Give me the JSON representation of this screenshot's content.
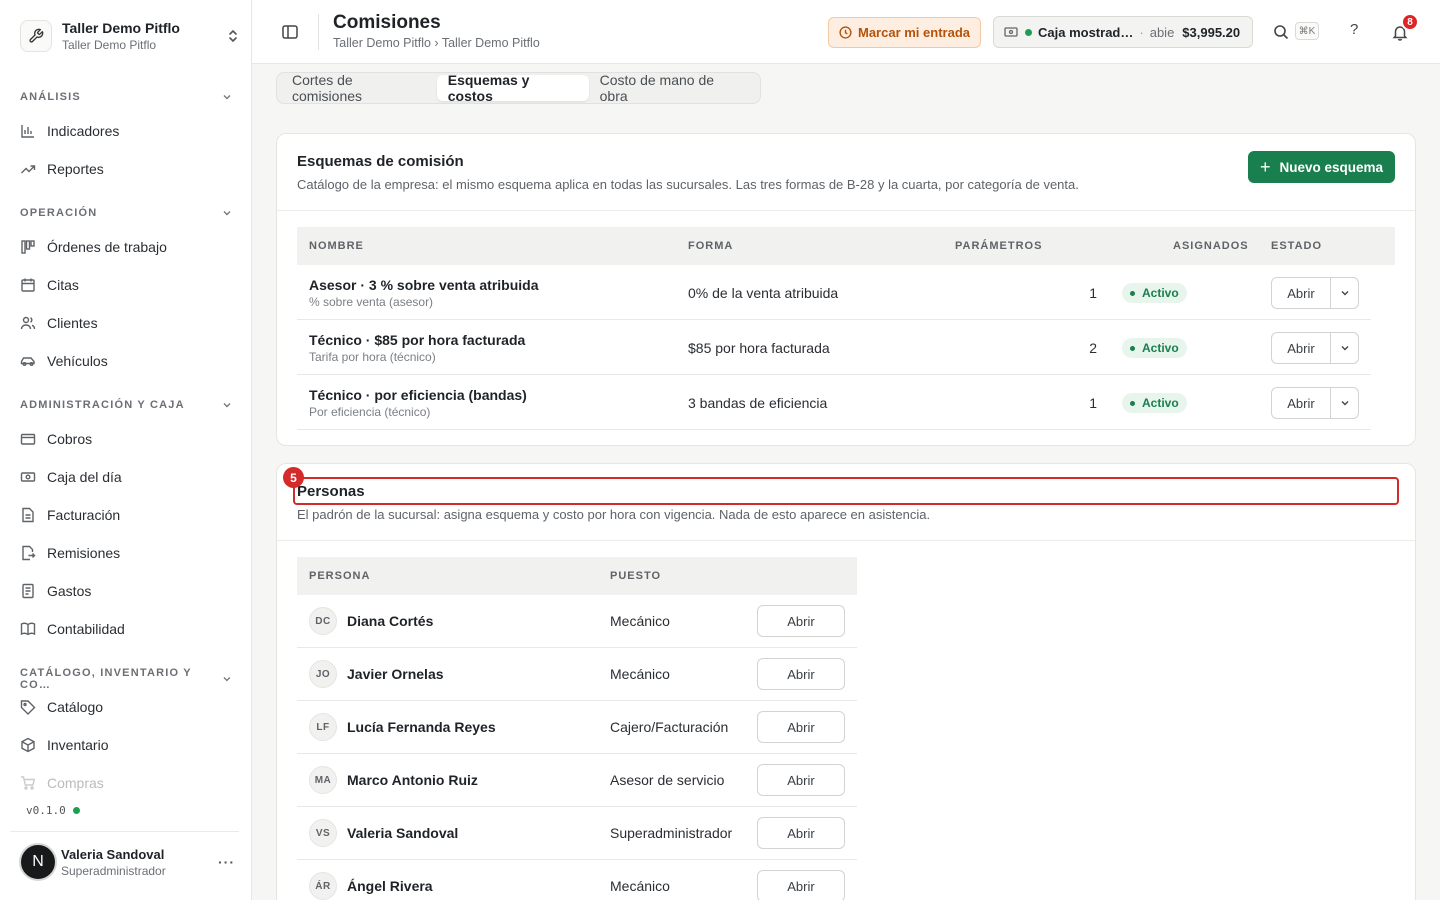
{
  "org": {
    "name": "Taller Demo Pitflo",
    "subtitle": "Taller Demo Pitflo"
  },
  "sidebar": {
    "sections": [
      {
        "label": "ANÁLISIS"
      },
      {
        "label": "OPERACIÓN"
      },
      {
        "label": "ADMINISTRACIÓN Y CAJA"
      },
      {
        "label": "CATÁLOGO, INVENTARIO Y CO…"
      }
    ],
    "items": [
      {
        "label": "Indicadores",
        "icon": "bar-chart-icon"
      },
      {
        "label": "Reportes",
        "icon": "trend-icon"
      },
      {
        "label": "Órdenes de trabajo",
        "icon": "kanban-icon"
      },
      {
        "label": "Citas",
        "icon": "calendar-icon"
      },
      {
        "label": "Clientes",
        "icon": "users-icon"
      },
      {
        "label": "Vehículos",
        "icon": "car-icon"
      },
      {
        "label": "Cobros",
        "icon": "wallet-icon"
      },
      {
        "label": "Caja del día",
        "icon": "cash-icon"
      },
      {
        "label": "Facturación",
        "icon": "file-icon"
      },
      {
        "label": "Remisiones",
        "icon": "file-export-icon"
      },
      {
        "label": "Gastos",
        "icon": "receipt-icon"
      },
      {
        "label": "Contabilidad",
        "icon": "book-icon"
      },
      {
        "label": "Catálogo",
        "icon": "tag-icon"
      },
      {
        "label": "Inventario",
        "icon": "box-icon"
      },
      {
        "label": "Compras",
        "icon": "cart-icon"
      }
    ],
    "version": "v0.1.0",
    "user": {
      "initial": "N",
      "name": "Valeria Sandoval",
      "role": "Superadministrador",
      "more": "···"
    }
  },
  "header": {
    "title": "Comisiones",
    "breadcrumb": "Taller Demo Pitflo › Taller Demo Pitflo",
    "clock_in": "Marcar mi entrada",
    "register": {
      "name": "Caja mostrad…",
      "separator": "·",
      "state": "abie",
      "amount": "$3,995.20"
    },
    "shortcut": "⌘K",
    "help": "?",
    "notifications": "8"
  },
  "tabs": [
    {
      "label": "Cortes de comisiones"
    },
    {
      "label": "Esquemas y costos"
    },
    {
      "label": "Costo de mano de obra"
    }
  ],
  "schemes": {
    "title": "Esquemas de comisión",
    "description": "Catálogo de la empresa: el mismo esquema aplica en todas las sucursales. Las tres formas de B-28 y la cuarta, por categoría de venta.",
    "new_button": "Nuevo esquema",
    "columns": {
      "name": "NOMBRE",
      "form": "FORMA",
      "params": "PARÁMETROS",
      "assigned": "ASIGNADOS",
      "status": "ESTADO"
    },
    "rows": [
      {
        "name": "Asesor · 3 % sobre venta atribuida",
        "sub": "% sobre venta (asesor)",
        "form": "0% de la venta atribuida",
        "params": "1",
        "status": "Activo",
        "action": "Abrir"
      },
      {
        "name": "Técnico · $85 por hora facturada",
        "sub": "Tarifa por hora (técnico)",
        "form": "$85 por hora facturada",
        "params": "2",
        "status": "Activo",
        "action": "Abrir"
      },
      {
        "name": "Técnico · por eficiencia (bandas)",
        "sub": "Por eficiencia (técnico)",
        "form": "3 bandas de eficiencia",
        "params": "1",
        "status": "Activo",
        "action": "Abrir"
      }
    ]
  },
  "people": {
    "marker": "5",
    "title": "Personas",
    "description": "El padrón de la sucursal: asigna esquema y costo por hora con vigencia. Nada de esto aparece en asistencia.",
    "columns": {
      "person": "PERSONA",
      "role": "PUESTO"
    },
    "rows": [
      {
        "initials": "DC",
        "name": "Diana Cortés",
        "role": "Mecánico",
        "action": "Abrir"
      },
      {
        "initials": "JO",
        "name": "Javier Ornelas",
        "role": "Mecánico",
        "action": "Abrir"
      },
      {
        "initials": "LF",
        "name": "Lucía Fernanda Reyes",
        "role": "Cajero/Facturación",
        "action": "Abrir"
      },
      {
        "initials": "MA",
        "name": "Marco Antonio Ruiz",
        "role": "Asesor de servicio",
        "action": "Abrir"
      },
      {
        "initials": "VS",
        "name": "Valeria Sandoval",
        "role": "Superadministrador",
        "action": "Abrir"
      },
      {
        "initials": "ÁR",
        "name": "Ángel Rivera",
        "role": "Mecánico",
        "action": "Abrir"
      }
    ]
  }
}
